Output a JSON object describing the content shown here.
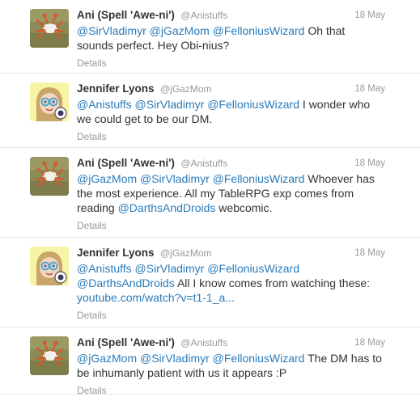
{
  "tweets": [
    {
      "fullname": "Ani (Spell 'Awe-ni')",
      "screenname": "@Anistuffs",
      "time": "18 May",
      "avatar_icon": "crab-icon",
      "mentions": [
        "@SirVladimyr",
        "@jGazMom",
        "@FelloniusWizard"
      ],
      "text": "Oh that sounds perfect. Hey Obi-nius?",
      "details": "Details"
    },
    {
      "fullname": "Jennifer Lyons",
      "screenname": "@jGazMom",
      "time": "18 May",
      "avatar_icon": "cartoon-girl-icon",
      "mentions": [
        "@Anistuffs",
        "@SirVladimyr",
        "@FelloniusWizard"
      ],
      "text": "I wonder who we could get to be our DM.",
      "details": "Details"
    },
    {
      "fullname": "Ani (Spell 'Awe-ni')",
      "screenname": "@Anistuffs",
      "time": "18 May",
      "avatar_icon": "crab-icon",
      "mentions": [
        "@jGazMom",
        "@SirVladimyr",
        "@FelloniusWizard"
      ],
      "text_before": "Whoever has the most experience. All my TableRPG exp comes from reading",
      "inline_mention": "@DarthsAndDroids",
      "text_after": "webcomic.",
      "details": "Details"
    },
    {
      "fullname": "Jennifer Lyons",
      "screenname": "@jGazMom",
      "time": "18 May",
      "avatar_icon": "cartoon-girl-icon",
      "mentions": [
        "@Anistuffs",
        "@SirVladimyr",
        "@FelloniusWizard",
        "@DarthsAndDroids"
      ],
      "text": "All I know comes from watching these:",
      "url": "youtube.com/watch?v=t1-1_a...",
      "details": "Details"
    },
    {
      "fullname": "Ani (Spell 'Awe-ni')",
      "screenname": "@Anistuffs",
      "time": "18 May",
      "avatar_icon": "crab-icon",
      "mentions": [
        "@jGazMom",
        "@SirVladimyr",
        "@FelloniusWizard"
      ],
      "text": "The DM has to be inhumanly patient with us it appears :P",
      "details": "Details"
    }
  ],
  "colors": {
    "link": "#2b7bb9",
    "muted": "#999999",
    "text": "#333333",
    "divider": "#e8e8e8"
  }
}
